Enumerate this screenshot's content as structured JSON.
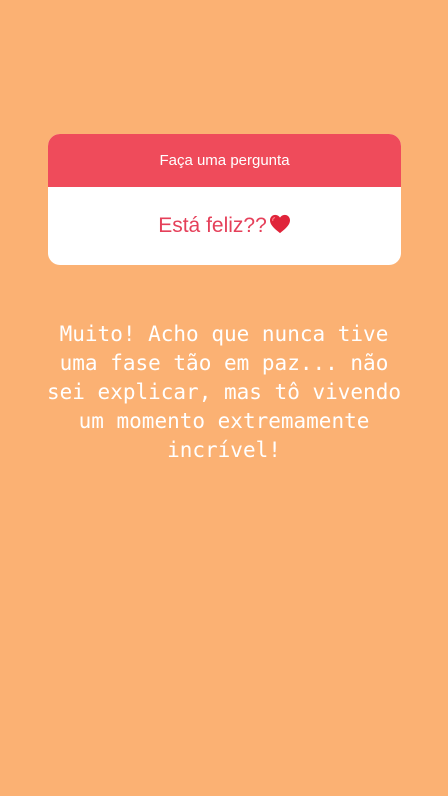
{
  "question_sticker": {
    "header_label": "Faça uma pergunta",
    "question": "Está feliz??",
    "question_emoji": "heart-icon",
    "header_color": "#EF4B5B",
    "question_color": "#E5405A"
  },
  "answer": {
    "text": "Muito! Acho que nunca tive\numa fase tão em paz... não\nsei explicar, mas tô vivendo\num momento extremamente\nincrível!"
  },
  "background_color": "#FBB173"
}
